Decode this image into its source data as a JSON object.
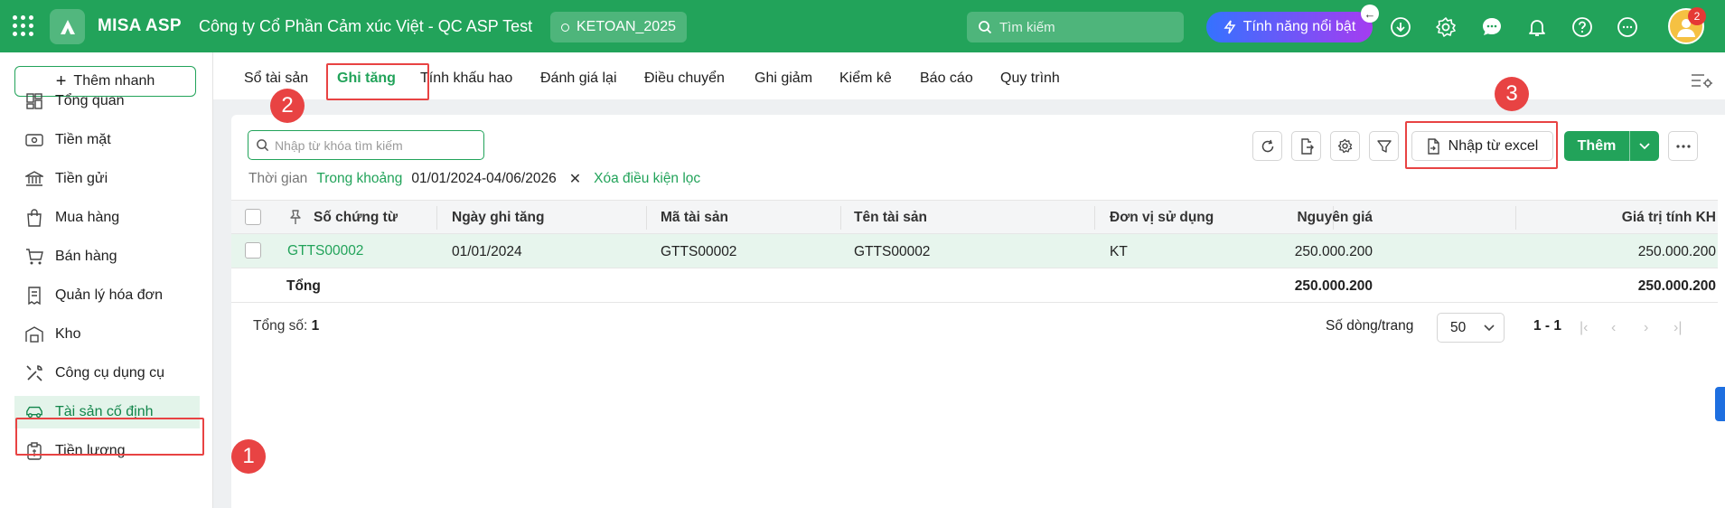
{
  "header": {
    "brand": "MISA ASP",
    "company": "Công ty Cổ Phần Cảm xúc Việt - QC ASP Test",
    "database": "KETOAN_2025",
    "search_placeholder": "Tìm kiếm",
    "feature_label": "Tính năng nổi bật",
    "notification_count": "2"
  },
  "sidebar": {
    "quick_add": "Thêm nhanh",
    "items": [
      {
        "label": "Tổng quan",
        "icon": "dashboard-icon"
      },
      {
        "label": "Tiền mặt",
        "icon": "cash-icon"
      },
      {
        "label": "Tiền gửi",
        "icon": "bank-icon"
      },
      {
        "label": "Mua hàng",
        "icon": "shopping-bag-icon"
      },
      {
        "label": "Bán hàng",
        "icon": "cart-icon"
      },
      {
        "label": "Quản lý hóa đơn",
        "icon": "invoice-icon"
      },
      {
        "label": "Kho",
        "icon": "warehouse-icon"
      },
      {
        "label": "Công cụ dụng cụ",
        "icon": "tools-icon"
      },
      {
        "label": "Tài sản cố định",
        "icon": "car-icon",
        "active": true
      },
      {
        "label": "Tiền lương",
        "icon": "payroll-icon"
      }
    ]
  },
  "tabs": [
    {
      "label": "Sổ tài sản"
    },
    {
      "label": "Ghi tăng",
      "active": true
    },
    {
      "label": "Tính khấu hao"
    },
    {
      "label": "Đánh giá lại"
    },
    {
      "label": "Điều chuyển"
    },
    {
      "label": "Ghi giảm"
    },
    {
      "label": "Kiểm kê"
    },
    {
      "label": "Báo cáo"
    },
    {
      "label": "Quy trình"
    }
  ],
  "toolbar": {
    "search_placeholder": "Nhập từ khóa tìm kiếm",
    "import_label": "Nhập từ excel",
    "add_label": "Thêm"
  },
  "filter": {
    "label": "Thời gian",
    "mode": "Trong khoảng",
    "range": "01/01/2024-04/06/2026",
    "clear": "Xóa điều kiện lọc"
  },
  "table": {
    "columns": [
      "Số chứng từ",
      "Ngày ghi tăng",
      "Mã tài sản",
      "Tên tài sản",
      "Đơn vị sử dụng",
      "Nguyên giá",
      "Giá trị tính KH"
    ],
    "rows": [
      {
        "voucher": "GTTS00002",
        "date": "01/01/2024",
        "asset_code": "GTTS00002",
        "asset_name": "GTTS00002",
        "unit": "KT",
        "cost": "250.000.200",
        "depreciable": "250.000.200"
      }
    ],
    "total_label": "Tổng",
    "total_cost": "250.000.200",
    "total_depreciable": "250.000.200"
  },
  "pagination": {
    "total_label": "Tổng số:",
    "total_value": "1",
    "rows_per_page_label": "Số dòng/trang",
    "page_size": "50",
    "range": "1 - 1"
  },
  "annotations": [
    "1",
    "2",
    "3"
  ]
}
